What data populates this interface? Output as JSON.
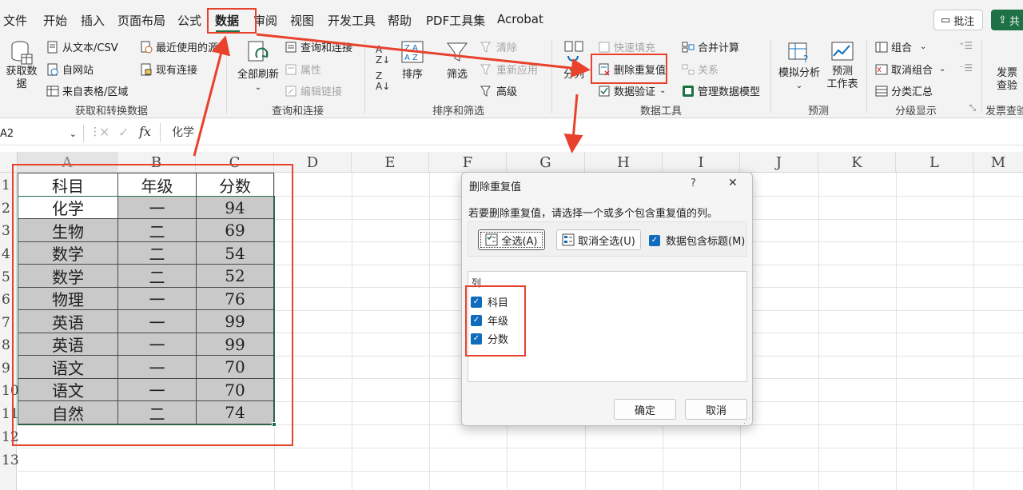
{
  "tabs": [
    "文件",
    "开始",
    "插入",
    "页面布局",
    "公式",
    "数据",
    "审阅",
    "视图",
    "开发工具",
    "帮助",
    "PDF工具集",
    "Acrobat"
  ],
  "active_tab": "数据",
  "top_buttons": {
    "comment": "批注",
    "share": "共"
  },
  "ribbon": {
    "get_data": {
      "big_label_1": "获取数",
      "big_label_2": "据",
      "from_text": "从文本/CSV",
      "from_web": "自网站",
      "from_table": "来自表格/区域",
      "recent": "最近使用的源",
      "existing": "现有连接",
      "group": "获取和转换数据"
    },
    "queries": {
      "refresh_all": "全部刷新",
      "queries_connections": "查询和连接",
      "properties": "属性",
      "edit_links": "编辑链接",
      "group": "查询和连接"
    },
    "sort_filter": {
      "sort": "排序",
      "filter": "筛选",
      "clear": "清除",
      "reapply": "重新应用",
      "advanced": "高级",
      "group": "排序和筛选"
    },
    "data_tools": {
      "text_to_columns": "分列",
      "flash_fill": "快速填充",
      "remove_duplicates": "删除重复值",
      "validation": "数据验证",
      "consolidate": "合并计算",
      "relationships": "关系",
      "data_model": "管理数据模型",
      "group": "数据工具"
    },
    "forecast": {
      "what_if": "模拟分析",
      "forecast_sheet_1": "预测",
      "forecast_sheet_2": "工作表",
      "group": "预测"
    },
    "outline": {
      "group_btn": "组合",
      "ungroup": "取消组合",
      "subtotal": "分类汇总",
      "group": "分级显示"
    },
    "invoice": {
      "label_1": "发票",
      "label_2": "查验",
      "group": "发票查验"
    }
  },
  "formula_bar": {
    "name_box": "A2",
    "fx": "fx",
    "content": "化学"
  },
  "columns": [
    "A",
    "B",
    "C",
    "D",
    "E",
    "F",
    "G",
    "H",
    "I",
    "J",
    "K",
    "L",
    "M"
  ],
  "rows": [
    "1",
    "2",
    "3",
    "4",
    "5",
    "6",
    "7",
    "8",
    "9",
    "10",
    "11",
    "12",
    "13"
  ],
  "table": {
    "headers": [
      "科目",
      "年级",
      "分数"
    ],
    "rows": [
      [
        "化学",
        "一",
        "94"
      ],
      [
        "生物",
        "二",
        "69"
      ],
      [
        "数学",
        "二",
        "54"
      ],
      [
        "数学",
        "二",
        "52"
      ],
      [
        "物理",
        "一",
        "76"
      ],
      [
        "英语",
        "一",
        "99"
      ],
      [
        "英语",
        "一",
        "99"
      ],
      [
        "语文",
        "一",
        "70"
      ],
      [
        "语文",
        "一",
        "70"
      ],
      [
        "自然",
        "二",
        "74"
      ]
    ]
  },
  "dialog": {
    "title": "删除重复值",
    "help": "?",
    "close": "✕",
    "instruction": "若要删除重复值，请选择一个或多个包含重复值的列。",
    "select_all": "全选(A)",
    "unselect_all": "取消全选(U)",
    "has_headers": "数据包含标题(M)",
    "columns_label": "列",
    "column_items": [
      "科目",
      "年级",
      "分数"
    ],
    "ok": "确定",
    "cancel": "取消"
  },
  "colors": {
    "accent_green": "#1e7145",
    "annotation_red": "#e8412c",
    "checkbox_blue": "#0f6cbd",
    "selected_cell_grey": "#c9c9c9"
  }
}
